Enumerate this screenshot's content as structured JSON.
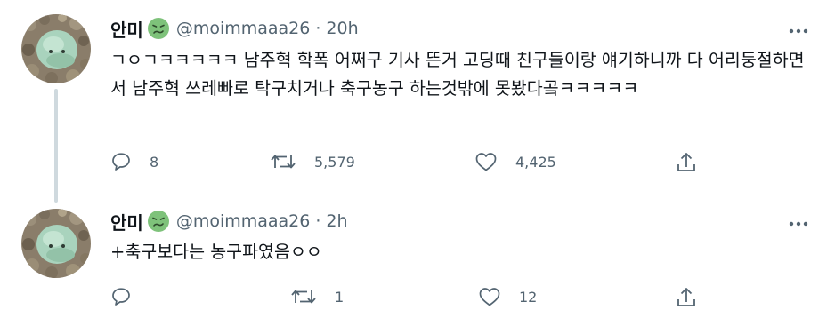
{
  "tweets": [
    {
      "author": {
        "display_name": "안미",
        "emoji_icon": "nauseated-face-icon",
        "handle": "@moimmaaa26"
      },
      "separator": "·",
      "time": "20h",
      "text": "ㄱㅇㄱㅋㅋㅋㅋㅋ 남주혁 학폭 어쩌구 기사 뜬거 고딩때 친구들이랑 얘기하니까 다 어리둥절하면서 남주혁 쓰레빠로 탁구치거나 축구농구 하는것밖에 못봤다곸ㅋㅋㅋㅋㅋ",
      "replies": "8",
      "retweets": "5,579",
      "likes": "4,425"
    },
    {
      "author": {
        "display_name": "안미",
        "emoji_icon": "nauseated-face-icon",
        "handle": "@moimmaaa26"
      },
      "separator": "·",
      "time": "2h",
      "text": "+축구보다는 농구파였음ㅇㅇ",
      "replies": "",
      "retweets": "1",
      "likes": "12"
    }
  ],
  "colors": {
    "text_primary": "#0f1419",
    "text_secondary": "#536471",
    "thread_line": "#cfd9de",
    "emoji_green": "#7ec27a"
  }
}
